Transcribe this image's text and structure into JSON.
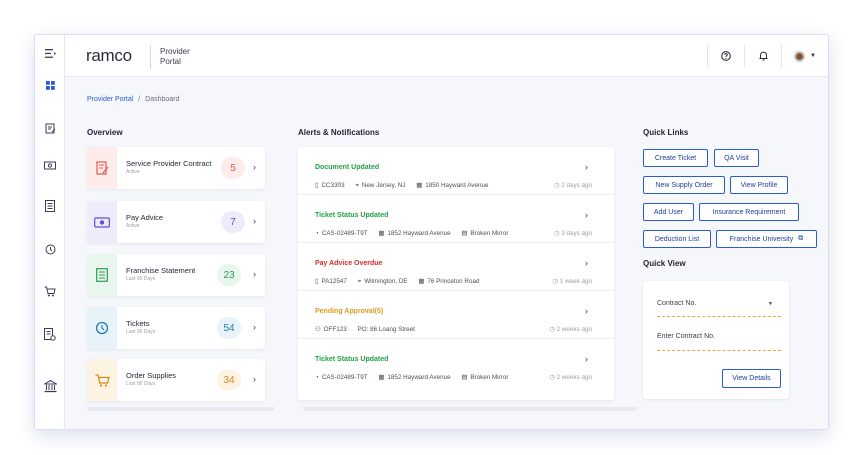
{
  "header": {
    "logo": "ramco",
    "portal_line1": "Provider",
    "portal_line2": "Portal",
    "help_icon": "help-circle-icon",
    "bell_icon": "bell-icon"
  },
  "sidebar": {
    "icons": [
      "menu-collapse-icon",
      "dashboard-icon",
      "contract-icon",
      "pay-advice-icon",
      "statement-icon",
      "tickets-icon",
      "cart-icon",
      "document-settings-icon",
      "bank-icon"
    ]
  },
  "breadcrumb": {
    "root": "Provider Portal",
    "separator": "/",
    "current": "Dashboard"
  },
  "overview": {
    "title": "Overview",
    "cards": [
      {
        "label": "Service Provider Contract",
        "sub": "Active",
        "count": "5",
        "color": "#e8574a"
      },
      {
        "label": "Pay Advice",
        "sub": "Active",
        "count": "7",
        "color": "#5b4fd6"
      },
      {
        "label": "Franchise Statement",
        "sub": "Last 90 Days",
        "count": "23",
        "color": "#2f9a57"
      },
      {
        "label": "Tickets",
        "sub": "Last 90 Days",
        "count": "54",
        "color": "#1d7ea8"
      },
      {
        "label": "Order Supplies",
        "sub": "Last 90 Days",
        "count": "34",
        "color": "#d88a1c"
      }
    ]
  },
  "alerts": {
    "title": "Alerts & Notifications",
    "items": [
      {
        "title": "Document  Updated",
        "color": "#23a143",
        "meta": [
          "CC3303",
          "New Jersey, NJ",
          "1850 Hayward Avenue"
        ],
        "time": "2 days ago"
      },
      {
        "title": "Ticket Status Updated",
        "color": "#23a143",
        "meta": [
          "CAS-02489-T9T",
          "1852 Hayward Avenue",
          "Broken Mirror"
        ],
        "time": "3 days ago"
      },
      {
        "title": "Pay Advice Overdue",
        "color": "#d62d2d",
        "meta": [
          "PA12547",
          "Wilmington, DE",
          "76 Princeton Road"
        ],
        "time": "1 week ago"
      },
      {
        "title": "Pending Approval(5)",
        "color": "#e29a1f",
        "meta": [
          "OFF123",
          "PO: 86 Loang Street"
        ],
        "time": "2 weeks ago"
      },
      {
        "title": "Ticket Status Updated",
        "color": "#23a143",
        "meta": [
          "CAS-02489-T9T",
          "1852 Hayward Avenue",
          "Broken Mirror"
        ],
        "time": "2 weeks ago"
      }
    ]
  },
  "quick_links": {
    "title": "Quick Links",
    "items": [
      "Create Ticket",
      "QA Visit",
      "New Supply Order",
      "View Profile",
      "Add User",
      "Insurance Requirement",
      "Deduction List",
      "Franchise University"
    ]
  },
  "quick_view": {
    "title": "Quick View",
    "select_label": "Contract No.",
    "input_placeholder": "Enter Contract No.",
    "button": "View Details"
  }
}
